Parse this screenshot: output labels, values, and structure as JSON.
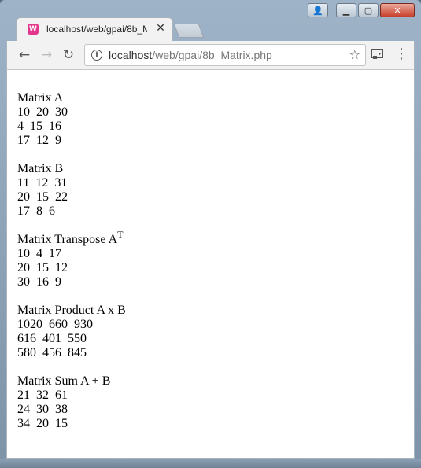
{
  "browser": {
    "tab_title": "localhost/web/gpai/8b_M",
    "url_host": "localhost",
    "url_path": "/web/gpai/8b_Matrix.php"
  },
  "content": {
    "blocks": [
      {
        "title": "Matrix A",
        "sup": "",
        "rows": [
          "10  20  30",
          "4  15  16",
          "17  12  9"
        ]
      },
      {
        "title": "Matrix B",
        "sup": "",
        "rows": [
          "11  12  31",
          "20  15  22",
          "17  8  6"
        ]
      },
      {
        "title": "Matrix Transpose A",
        "sup": "T",
        "rows": [
          "10  4  17",
          "20  15  12",
          "30  16  9"
        ]
      },
      {
        "title": "Matrix Product A x B",
        "sup": "",
        "rows": [
          "1020  660  930",
          "616  401  550",
          "580  456  845"
        ]
      },
      {
        "title": "Matrix Sum A + B",
        "sup": "",
        "rows": [
          "21  32  61",
          "24  30  38",
          "34  20  15"
        ]
      }
    ]
  }
}
